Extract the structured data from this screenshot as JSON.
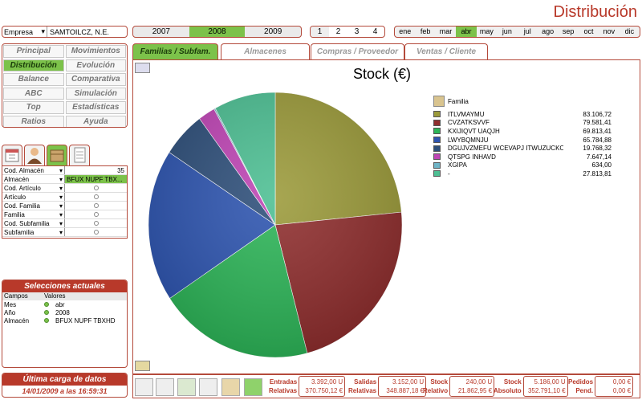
{
  "title": "Distribución",
  "empresa": {
    "label": "Empresa",
    "value": "SAMTOILCZ, N.E."
  },
  "years": [
    "2007",
    "2008",
    "2009"
  ],
  "quarters": [
    "1",
    "2",
    "3",
    "4"
  ],
  "months": [
    "ene",
    "feb",
    "mar",
    "abr",
    "may",
    "jun",
    "jul",
    "ago",
    "sep",
    "oct",
    "nov",
    "dic"
  ],
  "nav": [
    "Principal",
    "Movimientos",
    "Distribución",
    "Evolución",
    "Balance",
    "Comparativa",
    "ABC",
    "Simulación",
    "Top",
    "Estadísticas",
    "Ratios",
    "Ayuda"
  ],
  "filters": [
    {
      "label": "Cod. Almacén",
      "value": "35"
    },
    {
      "label": "Almacén",
      "value": "BFUX NUPF TBX..."
    },
    {
      "label": "Cod. Artículo",
      "value": ""
    },
    {
      "label": "Artículo",
      "value": ""
    },
    {
      "label": "Cod. Familia",
      "value": ""
    },
    {
      "label": "Familia",
      "value": ""
    },
    {
      "label": "Cod. Subfamilia",
      "value": ""
    },
    {
      "label": "Subfamilia",
      "value": ""
    }
  ],
  "selecciones": {
    "title": "Selecciones actuales",
    "col1": "Campos",
    "col2": "Valores",
    "rows": [
      {
        "campo": "Mes",
        "valor": "abr"
      },
      {
        "campo": "Año",
        "valor": "2008"
      },
      {
        "campo": "Almacén",
        "valor": "BFUX NUPF TBXHD"
      }
    ]
  },
  "carga": {
    "title": "Última carga de datos",
    "date": "14/01/2009 a las 16:59:31"
  },
  "tabs": [
    "Familias / Subfam.",
    "Almacenes",
    "Compras / Proveedor",
    "Ventas / Cliente"
  ],
  "chart_data": {
    "type": "pie",
    "title": "Stock (€)",
    "legend_title": "Familia",
    "labels": [
      "ITLVMAYMU",
      "CVZATKSVVF",
      "KXIJIQVT UAQJH",
      "LWYBQMNJU",
      "DGUJVZMEFU WCEVAPJ ITWUZUCKOS",
      "QTSPG INHAVD",
      "XGIPA",
      "-"
    ],
    "display": [
      "83.106,72",
      "79.581,41",
      "69.813,41",
      "65.784,88",
      "19.768,32",
      "7.647,14",
      "634,00",
      "27.813,81"
    ],
    "values": [
      83106.72,
      79581.41,
      69813.41,
      65784.88,
      19768.32,
      7647.14,
      634.0,
      27813.81
    ],
    "colors": [
      "#9b9a3a",
      "#8f2e2e",
      "#2db558",
      "#2e55b0",
      "#2e4f7a",
      "#bf45b5",
      "#6fb5c7",
      "#4dbf93"
    ],
    "legend_placement": "right"
  },
  "stats": [
    {
      "l1": "Entradas",
      "l2": "Relativas",
      "v1": "3.392,00 U",
      "v2": "370.750,12 €"
    },
    {
      "l1": "Salidas",
      "l2": "Relativas",
      "v1": "3.152,00 U",
      "v2": "348.887,18 €"
    },
    {
      "l1": "Stock",
      "l2": "Relativo",
      "v1": "240,00 U",
      "v2": "21.862,95 €"
    },
    {
      "l1": "Stock",
      "l2": "Absoluto",
      "v1": "5.186,00 U",
      "v2": "352.791,10 €"
    },
    {
      "l1": "Pedidos",
      "l2": "Pend.",
      "v1": "0,00 €",
      "v2": "0,00 €"
    }
  ]
}
